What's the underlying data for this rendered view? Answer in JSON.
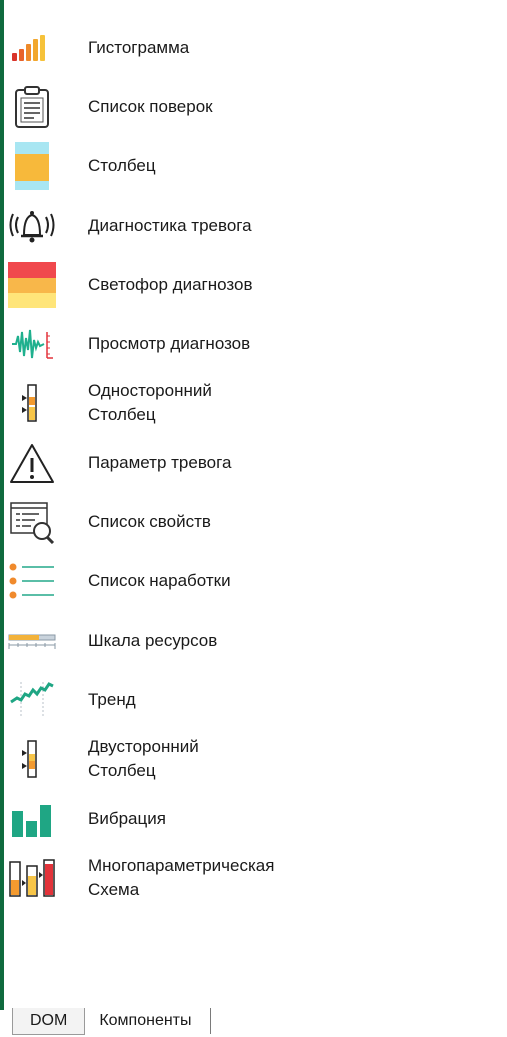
{
  "colors": {
    "accent": "#0f6b3e",
    "orange": "#f39a2f",
    "teal": "#23a88a",
    "red": "#e2333a",
    "yellow": "#ffd24d"
  },
  "toolbox": {
    "items": [
      {
        "label": "Гистограмма",
        "icon": "histogram-icon"
      },
      {
        "label": "Список поверок",
        "icon": "checklist-clipboard-icon"
      },
      {
        "label": "Столбец",
        "icon": "column-icon"
      },
      {
        "label": "Диагностика тревога",
        "icon": "alarm-bell-icon"
      },
      {
        "label": "Светофор диагнозов",
        "icon": "traffic-light-icon"
      },
      {
        "label": "Просмотр диагнозов",
        "icon": "waveform-icon"
      },
      {
        "label": "Односторонний\nСтолбец",
        "icon": "one-sided-column-icon"
      },
      {
        "label": "Параметр тревога",
        "icon": "warning-triangle-icon"
      },
      {
        "label": "Список свойств",
        "icon": "property-list-icon"
      },
      {
        "label": "Список наработки",
        "icon": "operating-list-icon"
      },
      {
        "label": "Шкала ресурсов",
        "icon": "resource-scale-icon"
      },
      {
        "label": "Тренд",
        "icon": "trend-icon"
      },
      {
        "label": "Двусторонний\nСтолбец",
        "icon": "two-sided-column-icon"
      },
      {
        "label": "Вибрация",
        "icon": "vibration-icon"
      },
      {
        "label": "Многопараметрическая\nСхема",
        "icon": "multi-parameter-scheme-icon"
      }
    ]
  },
  "tabs": [
    {
      "label": "DOM",
      "active": true
    },
    {
      "label": "Компоненты",
      "active": false
    }
  ]
}
